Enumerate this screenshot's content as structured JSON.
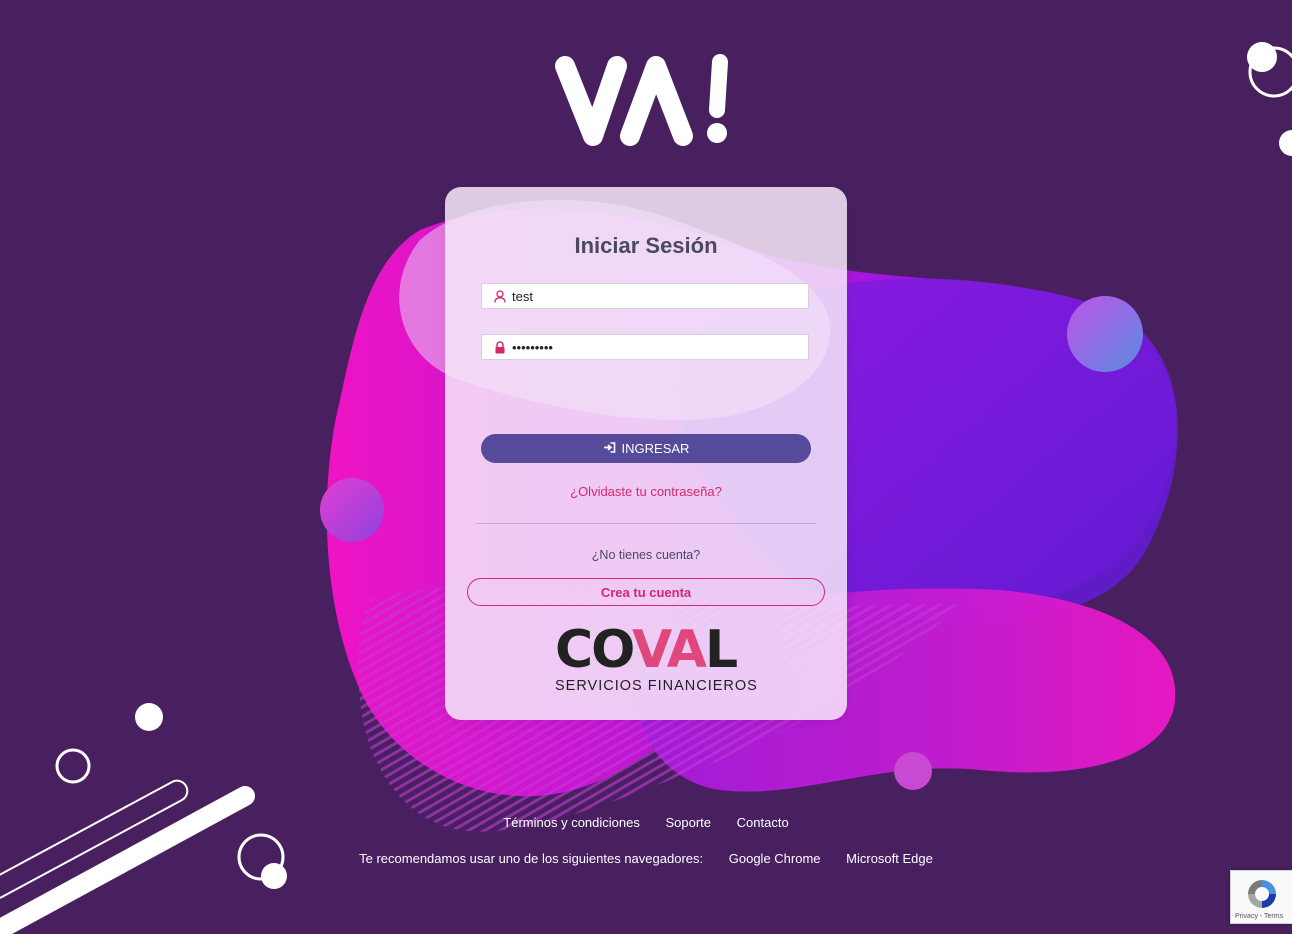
{
  "brand": {
    "logo_text": "VA!"
  },
  "login": {
    "title": "Iniciar Sesión",
    "username_value": "test",
    "password_value": "•••••••••",
    "submit_label": "INGRESAR",
    "forgot_label": "¿Olvidaste tu contraseña?",
    "no_account_label": "¿No tienes cuenta?",
    "create_account_label": "Crea tu cuenta"
  },
  "partner": {
    "name_left": "CO",
    "name_pink": "VA",
    "name_right": "L",
    "tagline": "SERVICIOS FINANCIEROS"
  },
  "footer": {
    "links": [
      "Términos y condiciones",
      "Soporte",
      "Contacto"
    ],
    "browsers_label": "Te recomendamos usar uno de los siguientes navegadores:",
    "browsers": [
      "Google Chrome",
      "Microsoft Edge"
    ]
  },
  "recaptcha": {
    "text": "Privacy - Terms"
  },
  "colors": {
    "background": "#48205f",
    "accent_pink": "#d8266e",
    "button_purple": "#564a9b",
    "magenta": "#e21cc8",
    "violet": "#8a1de0"
  },
  "icons": [
    "user-icon",
    "lock-icon",
    "sign-in-icon",
    "recaptcha-icon"
  ]
}
